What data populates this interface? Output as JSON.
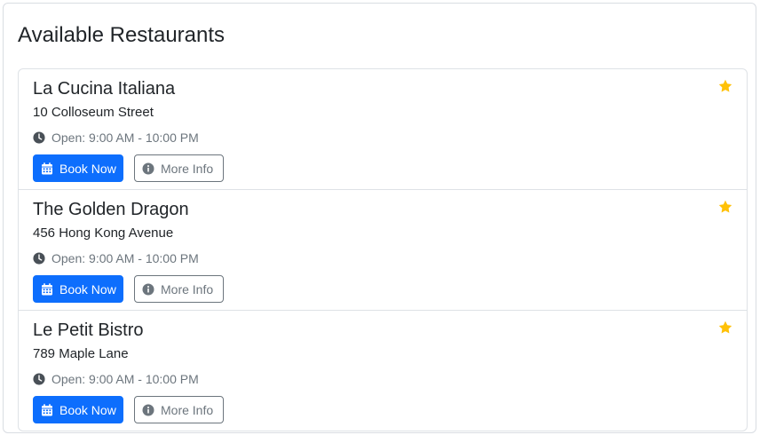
{
  "page": {
    "title": "Available Restaurants"
  },
  "restaurants": [
    {
      "name": "La Cucina Italiana",
      "address": "10 Colloseum Street",
      "hours": "Open: 9:00 AM - 10:00 PM",
      "favorite_icon": "star-icon",
      "book_label": "Book Now",
      "info_label": "More Info"
    },
    {
      "name": "The Golden Dragon",
      "address": "456 Hong Kong Avenue",
      "hours": "Open: 9:00 AM - 10:00 PM",
      "favorite_icon": "star-icon",
      "book_label": "Book Now",
      "info_label": "More Info"
    },
    {
      "name": "Le Petit Bistro",
      "address": "789 Maple Lane",
      "hours": "Open: 9:00 AM - 10:00 PM",
      "favorite_icon": "star-icon",
      "book_label": "Book Now",
      "info_label": "More Info"
    }
  ],
  "icons": {
    "favorite": "star-icon",
    "hours": "clock-icon",
    "book": "calendar-icon",
    "info": "info-circle-icon"
  },
  "colors": {
    "primary": "#0d6efd",
    "star": "#ffc107",
    "muted": "#6c757d",
    "text": "#212529",
    "border": "#dee2e6"
  }
}
